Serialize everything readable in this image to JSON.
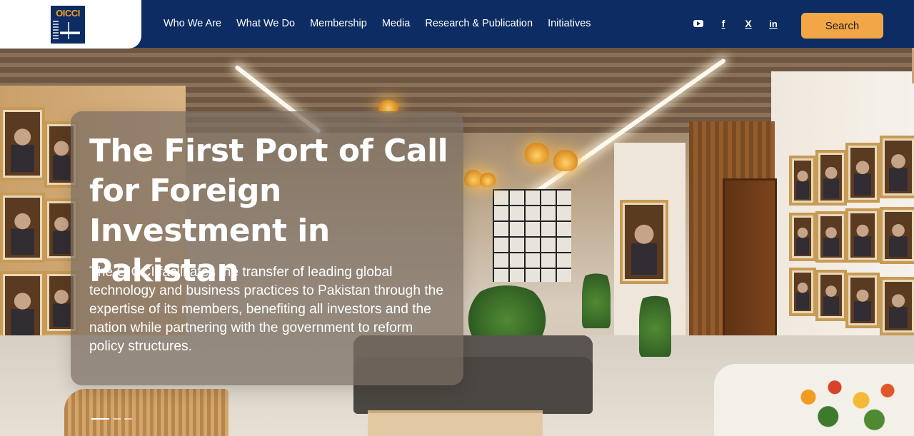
{
  "header": {
    "logo_text": "OICCI",
    "nav_items": [
      {
        "label": "Who We Are"
      },
      {
        "label": "What We Do"
      },
      {
        "label": "Membership"
      },
      {
        "label": "Media"
      },
      {
        "label": "Research & Publication"
      },
      {
        "label": "Initiatives"
      }
    ],
    "socials": [
      {
        "icon": "youtube-icon"
      },
      {
        "icon": "facebook-icon",
        "glyph": "f"
      },
      {
        "icon": "x-icon",
        "glyph": "X"
      },
      {
        "icon": "linkedin-icon",
        "glyph": "in"
      }
    ],
    "search_label": "Search"
  },
  "hero": {
    "title": "The First Port of Call for Foreign Investment in Pakistan",
    "description": "The OICCI facilitates the transfer of leading global technology and business practices to Pakistan through the expertise of its members, benefiting all investors and the nation while partnering with the government to reform policy structures.",
    "carousel": {
      "total_slides": 3,
      "active_slide": 1
    }
  },
  "colors": {
    "header_bg": "#0c2c63",
    "search_button": "#f3a648",
    "logo_accent": "#f3a023"
  }
}
